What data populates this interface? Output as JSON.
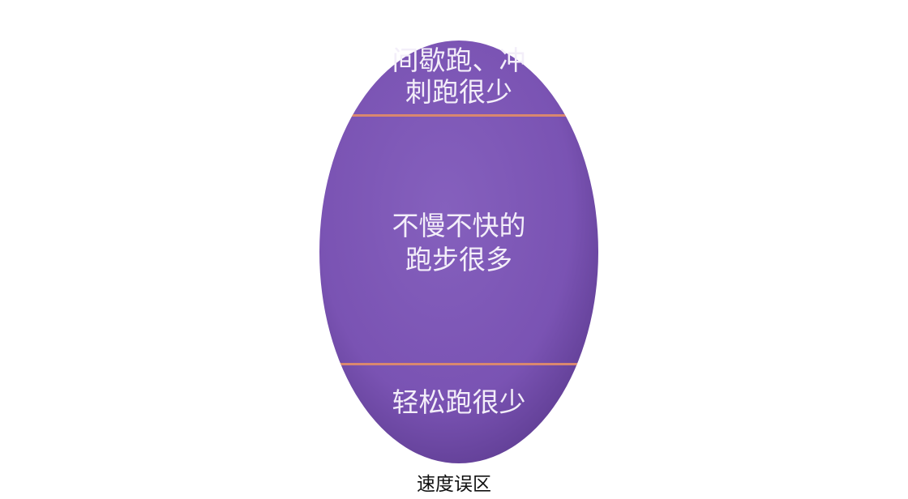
{
  "diagram": {
    "zones": [
      {
        "lines": [
          "间歇跑、冲",
          "刺跑很少"
        ]
      },
      {
        "lines": [
          "不慢不快的",
          "跑步很多"
        ]
      },
      {
        "lines": [
          "轻松跑很少"
        ]
      }
    ],
    "caption": "速度误区",
    "colors": {
      "fill": "#7c55b5",
      "fill_dark": "#5f3d93",
      "divider": "#d9876f",
      "text": "#f3eef9"
    }
  }
}
